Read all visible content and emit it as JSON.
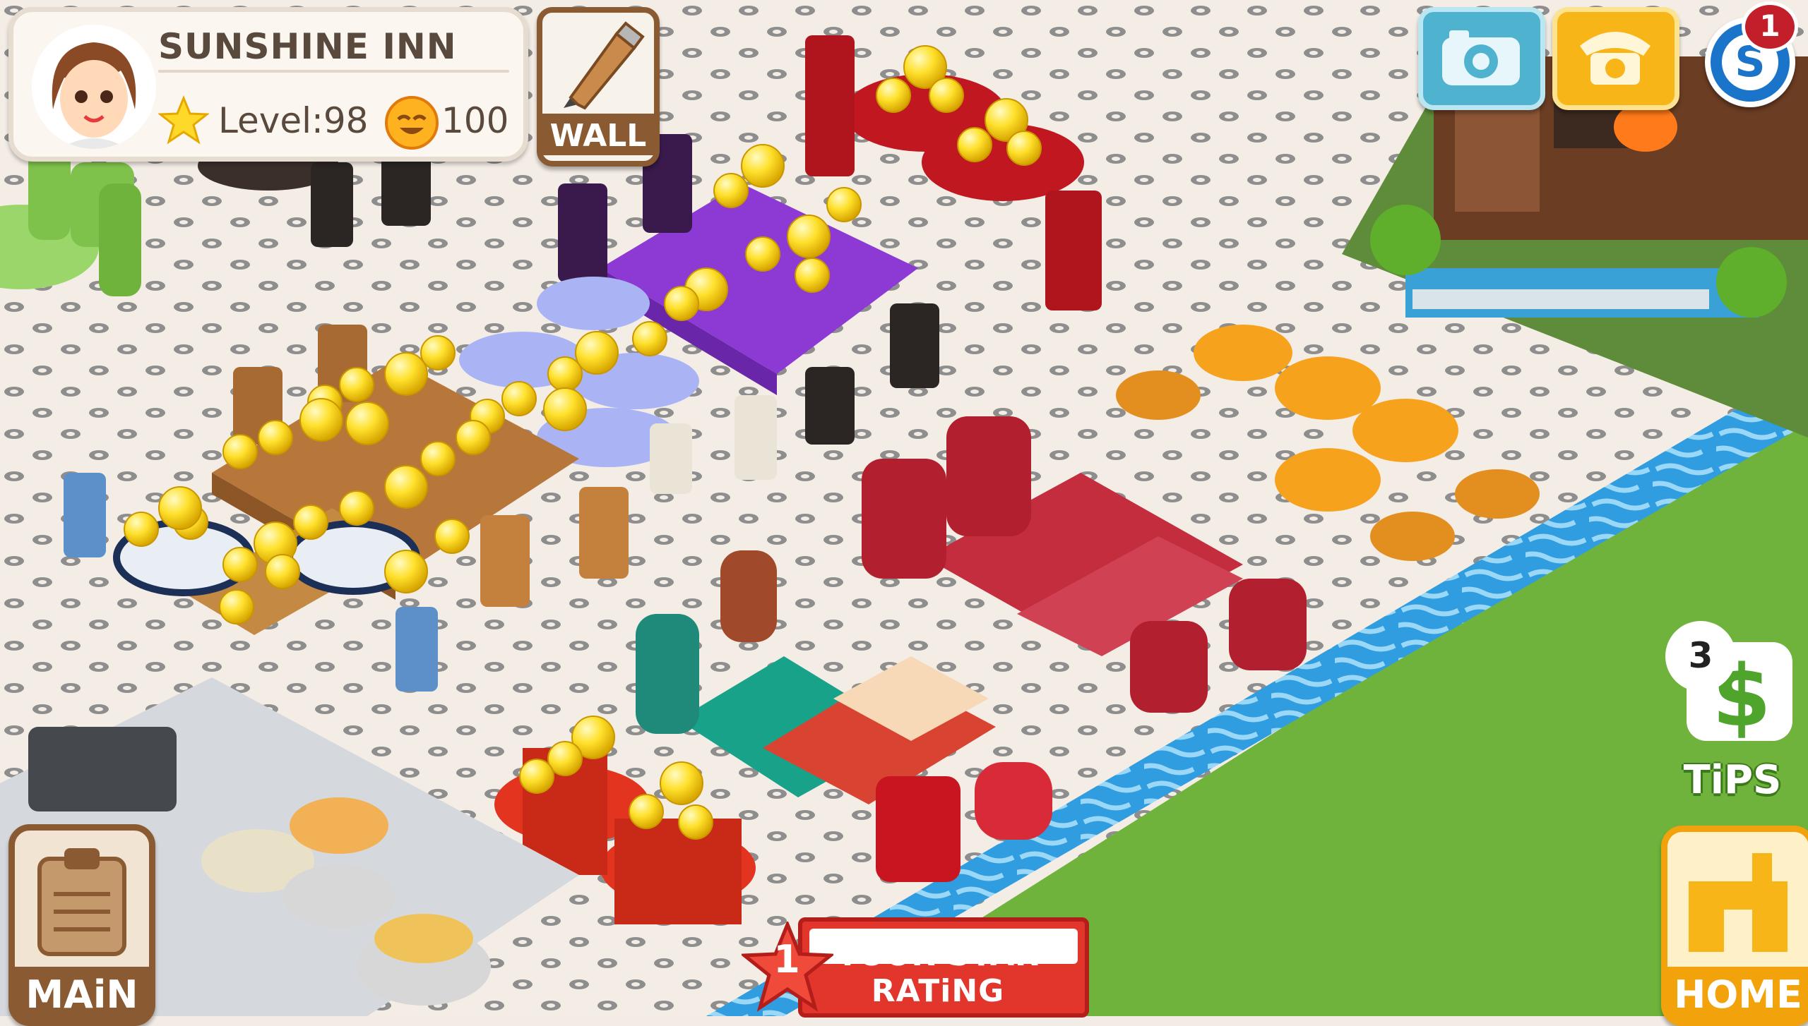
{
  "restaurant": {
    "name": "SUNSHINE INN",
    "level_label": "Level:",
    "level": "98",
    "coins": "100"
  },
  "buttons": {
    "wall_label": "WALL",
    "tips_label": "TiPS",
    "tips_count": "3",
    "home_label": "HOME",
    "main_label": "MAiN"
  },
  "notifications": {
    "social_count": "1"
  },
  "star_rating": {
    "label": "YOUR STAR RATiNG",
    "stars": "1",
    "progress": 0
  },
  "colors": {
    "grass": "#6fb33d",
    "floor": "#f3ece6",
    "water": "#2f9de0",
    "wall_accent": "#8a5a33",
    "home_accent": "#f2a30b",
    "rating_red": "#e2362c"
  },
  "icons": {
    "avatar": "chef-avatar-icon",
    "level": "star-icon",
    "coins": "smiley-coin-icon",
    "wall": "pencil-icon",
    "camera": "camera-icon",
    "phone": "telephone-icon",
    "social": "s-badge-icon",
    "tips": "dollar-sign-icon",
    "home": "house-icon",
    "main": "clipboard-icon"
  }
}
